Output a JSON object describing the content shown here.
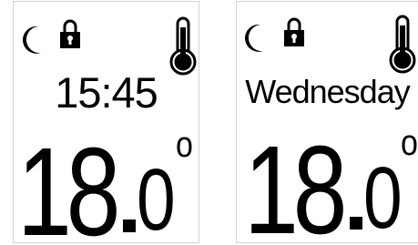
{
  "screens": [
    {
      "top_text": "15:45",
      "temp_integer": "18",
      "temp_decimal": "0",
      "degree_symbol": "o",
      "icons": [
        "moon-icon",
        "lock-icon",
        "thermometer-icon"
      ]
    },
    {
      "top_text": "Wednesday",
      "temp_integer": "18",
      "temp_decimal": "0",
      "degree_symbol": "o",
      "icons": [
        "moon-icon",
        "lock-icon",
        "thermometer-icon"
      ]
    }
  ],
  "colors": {
    "foreground": "#000000",
    "background": "#ffffff",
    "border": "#d4d4d4"
  }
}
